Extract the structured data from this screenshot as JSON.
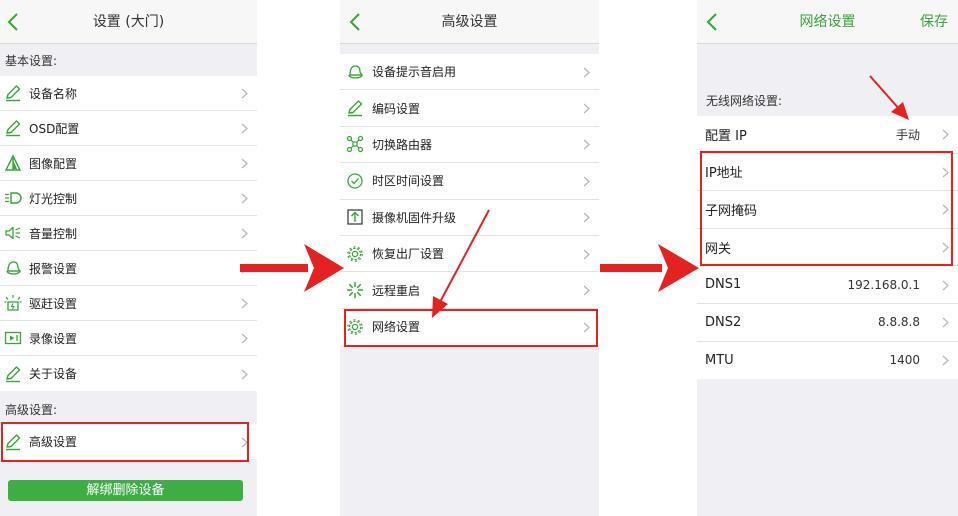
{
  "colors": {
    "accent_green": "#3aa33a",
    "highlight_red": "#e52222",
    "button_green": "#3cae45"
  },
  "panel1": {
    "title": "设置 (大门)",
    "basic_header": "基本设置:",
    "basic_items": [
      {
        "label": "设备名称",
        "icon": "pencil-icon"
      },
      {
        "label": "OSD配置",
        "icon": "pencil-icon"
      },
      {
        "label": "图像配置",
        "icon": "image-prism-icon"
      },
      {
        "label": "灯光控制",
        "icon": "light-icon"
      },
      {
        "label": "音量控制",
        "icon": "speaker-icon"
      },
      {
        "label": "报警设置",
        "icon": "bell-icon"
      },
      {
        "label": "驱赶设置",
        "icon": "alarm-light-icon"
      },
      {
        "label": "录像设置",
        "icon": "record-icon"
      },
      {
        "label": "关于设备",
        "icon": "pencil-icon"
      }
    ],
    "advanced_header": "高级设置:",
    "advanced_item": {
      "label": "高级设置",
      "icon": "pencil-icon"
    },
    "unbind_button": "解绑删除设备"
  },
  "panel2": {
    "title": "高级设置",
    "items": [
      {
        "label": "设备提示音启用",
        "icon": "bell-icon"
      },
      {
        "label": "编码设置",
        "icon": "pencil-icon"
      },
      {
        "label": "切换路由器",
        "icon": "router-icon"
      },
      {
        "label": "时区时间设置",
        "icon": "clock-icon"
      },
      {
        "label": "摄像机固件升级",
        "icon": "upload-icon"
      },
      {
        "label": "恢复出厂设置",
        "icon": "gear-icon"
      },
      {
        "label": "远程重启",
        "icon": "loading-icon"
      },
      {
        "label": "网络设置",
        "icon": "gear-icon"
      }
    ]
  },
  "panel3": {
    "title": "网络设置",
    "save": "保存",
    "section_header": "无线网络设置:",
    "rows": [
      {
        "label": "配置 IP",
        "value": "手动"
      },
      {
        "label": "IP地址",
        "value": ""
      },
      {
        "label": "子网掩码",
        "value": ""
      },
      {
        "label": "网关",
        "value": ""
      },
      {
        "label": "DNS1",
        "value": "192.168.0.1"
      },
      {
        "label": "DNS2",
        "value": "8.8.8.8"
      },
      {
        "label": "MTU",
        "value": "1400"
      }
    ]
  }
}
